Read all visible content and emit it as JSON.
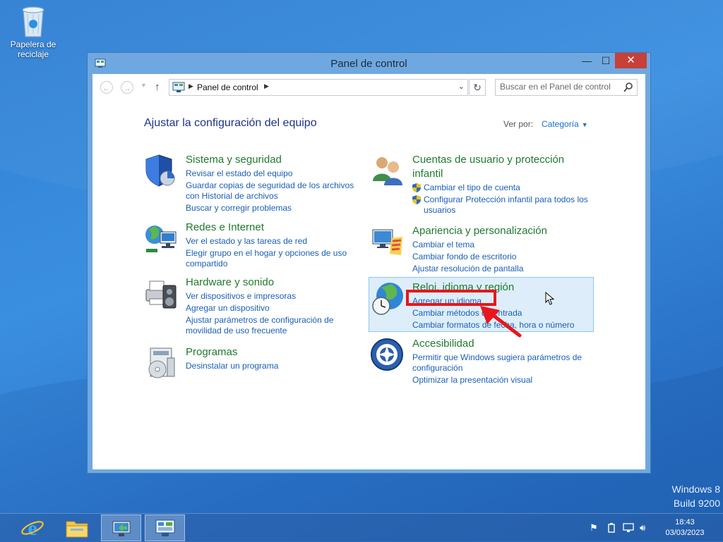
{
  "desktop": {
    "recycle_bin_label": "Papelera de reciclaje",
    "watermark_line1": "Windows 8",
    "watermark_line2": "Build 9200"
  },
  "window": {
    "title": "Panel de control",
    "controls": {
      "minimize": "—",
      "maximize": "☐",
      "close": "✕"
    }
  },
  "navbar": {
    "breadcrumb": "Panel de control",
    "search_placeholder": "Buscar en el Panel de control"
  },
  "main": {
    "heading": "Ajustar la configuración del equipo",
    "view_by_label": "Ver por:",
    "view_by_value": "Categoría",
    "left_column": [
      {
        "icon": "shield-icon",
        "title": "Sistema y seguridad",
        "links": [
          "Revisar el estado del equipo",
          "Guardar copias de seguridad de los archivos con Historial de archivos",
          "Buscar y corregir problemas"
        ]
      },
      {
        "icon": "network-icon",
        "title": "Redes e Internet",
        "links": [
          "Ver el estado y las tareas de red",
          "Elegir grupo en el hogar y opciones de uso compartido"
        ]
      },
      {
        "icon": "printer-icon",
        "title": "Hardware y sonido",
        "links": [
          "Ver dispositivos e impresoras",
          "Agregar un dispositivo",
          "Ajustar parámetros de configuración de movilidad de uso frecuente"
        ]
      },
      {
        "icon": "programs-icon",
        "title": "Programas",
        "links": [
          "Desinstalar un programa"
        ]
      }
    ],
    "right_column": [
      {
        "icon": "users-icon",
        "title": "Cuentas de usuario y protección infantil",
        "links": [
          "Cambiar el tipo de cuenta",
          "Configurar Protección infantil para todos los usuarios"
        ]
      },
      {
        "icon": "appearance-icon",
        "title": "Apariencia y personalización",
        "links": [
          "Cambiar el tema",
          "Cambiar fondo de escritorio",
          "Ajustar resolución de pantalla"
        ]
      },
      {
        "icon": "clock-globe-icon",
        "title": "Reloj, idioma y región",
        "links": [
          "Agregar un idioma",
          "Cambiar métodos de entrada",
          "Cambiar formatos de fecha, hora o número"
        ]
      },
      {
        "icon": "accessibility-icon",
        "title": "Accesibilidad",
        "links": [
          "Permitir que Windows sugiera parámetros de configuración",
          "Optimizar la presentación visual"
        ]
      }
    ]
  },
  "taskbar": {
    "items": [
      "internet-explorer-icon",
      "file-explorer-icon",
      "remote-app-icon",
      "control-panel-icon"
    ],
    "clock_time": "18:43",
    "clock_date": "03/03/2023"
  },
  "colors": {
    "category_title": "#1f7a2e",
    "link": "#1a5fb4",
    "annotation": "#e8161c",
    "close_button": "#c7403a"
  }
}
